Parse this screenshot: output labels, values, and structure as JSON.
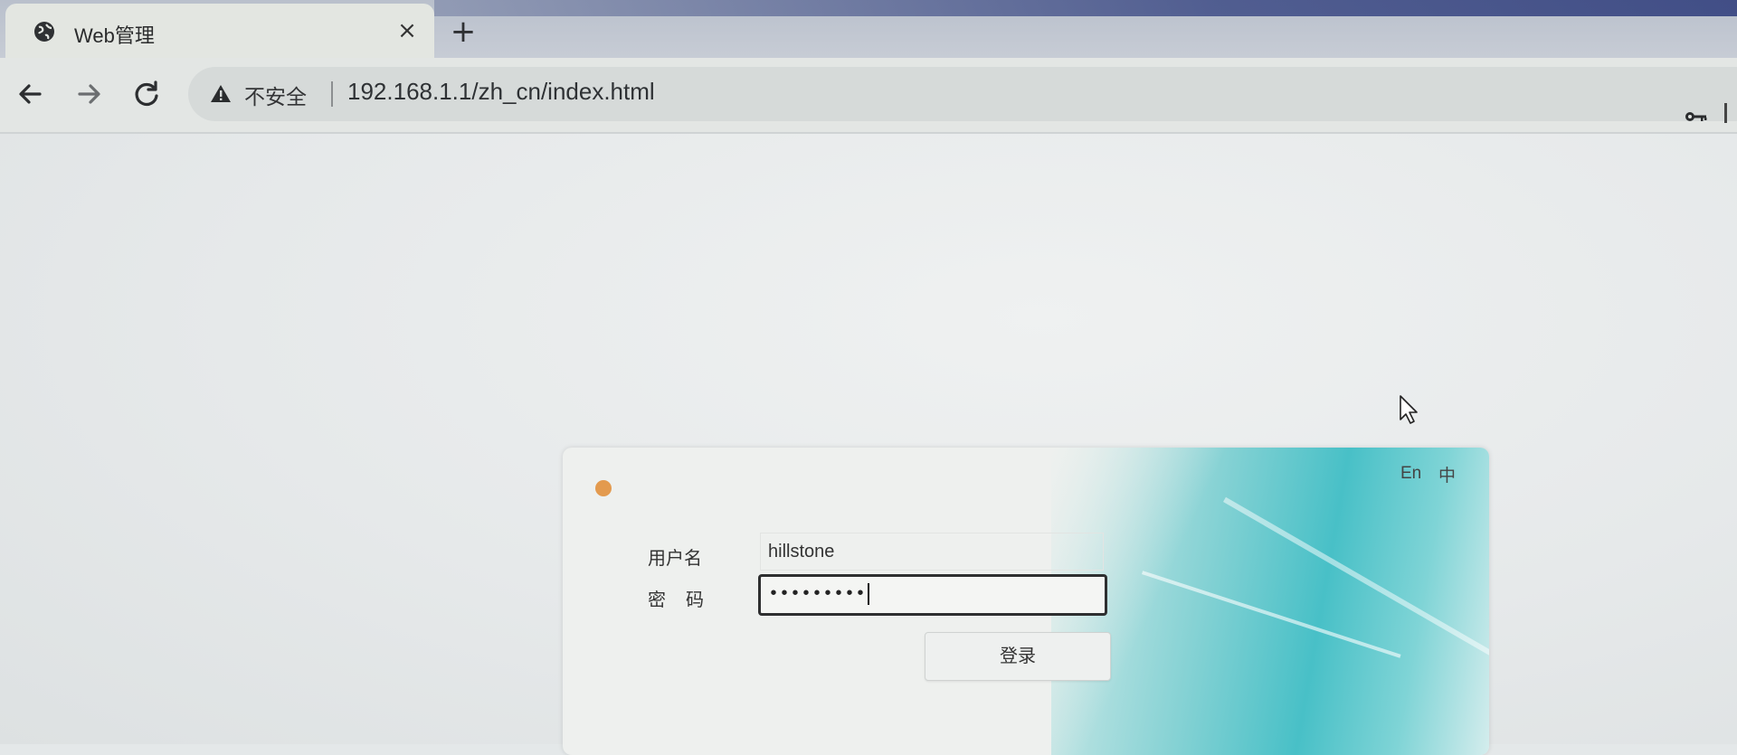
{
  "tab": {
    "title": "Web管理",
    "favicon": "globe-icon",
    "close": "×",
    "new_tab": "+"
  },
  "toolbar": {
    "back": "back-arrow-icon",
    "forward": "forward-arrow-icon",
    "reload": "reload-icon",
    "security_label": "不安全",
    "url": "192.168.1.1/zh_cn/index.html"
  },
  "login": {
    "lang_en": "En",
    "lang_zh": "中",
    "username_label": "用户名",
    "password_label": "密码",
    "username_value": "hillstone",
    "password_masked": "•••••••••",
    "submit_label": "登录"
  },
  "colors": {
    "brand_dot": "#e39a4e",
    "art_teal": "#48c0c7"
  }
}
